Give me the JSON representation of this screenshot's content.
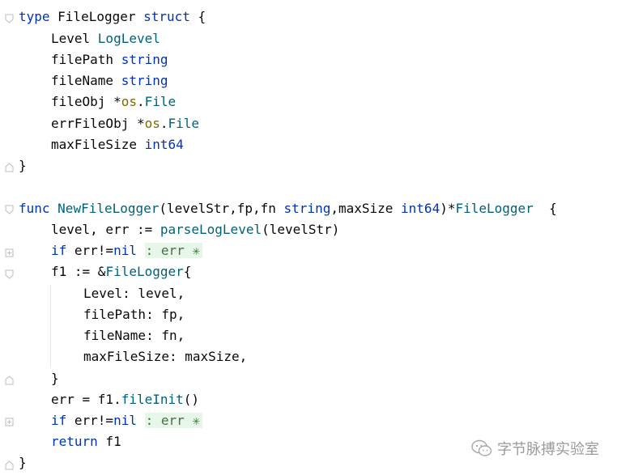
{
  "code": {
    "line1": {
      "kw": "type",
      "name": " FileLogger ",
      "kw2": "struct",
      "rest": " {"
    },
    "line2": {
      "field": "Level ",
      "type": "LogLevel"
    },
    "line3": {
      "field": "filePath ",
      "type": "string"
    },
    "line4": {
      "field": "fileName ",
      "type": "string"
    },
    "line5": {
      "field": "fileObj *",
      "pkg": "os",
      "dot": ".",
      "type": "File"
    },
    "line6": {
      "field": "errFileObj *",
      "pkg": "os",
      "dot": ".",
      "type": "File"
    },
    "line7": {
      "field": "maxFileSize ",
      "type": "int64"
    },
    "line8": {
      "text": "}"
    },
    "line10": {
      "kw": "func",
      "sp": " ",
      "fname": "NewFileLogger",
      "p1": "(levelStr,fp,fn ",
      "t1": "string",
      "p2": ",maxSize ",
      "t2": "int64",
      "p3": ")*",
      "rtype": "FileLogger",
      "rest": "  {"
    },
    "line11": {
      "a": "level, err := ",
      "call": "parseLogLevel",
      "b": "(levelStr)"
    },
    "line12": {
      "kw": "if",
      "a": " err!=",
      "nil": "nil",
      "fold": ": err ✳"
    },
    "line13": {
      "a": "f1 := &",
      "type": "FileLogger",
      "b": "{"
    },
    "line14": {
      "text": "Level: level,"
    },
    "line15": {
      "text": "filePath: fp,"
    },
    "line16": {
      "text": "fileName: fn,"
    },
    "line17": {
      "text": "maxFileSize: maxSize,"
    },
    "line18": {
      "text": "}"
    },
    "line19": {
      "a": "err = f1.",
      "call": "fileInit",
      "b": "()"
    },
    "line20": {
      "kw": "if",
      "a": " err!=",
      "nil": "nil",
      "fold": ": err ✳"
    },
    "line21": {
      "kw": "return",
      "a": " f1"
    },
    "line22": {
      "text": "}"
    }
  },
  "watermark": {
    "text": "字节脉搏实验室"
  },
  "colors": {
    "keyword": "#0033b3",
    "function": "#00627a",
    "package": "#7a6a00",
    "fold_bg": "#e8f5e9"
  }
}
